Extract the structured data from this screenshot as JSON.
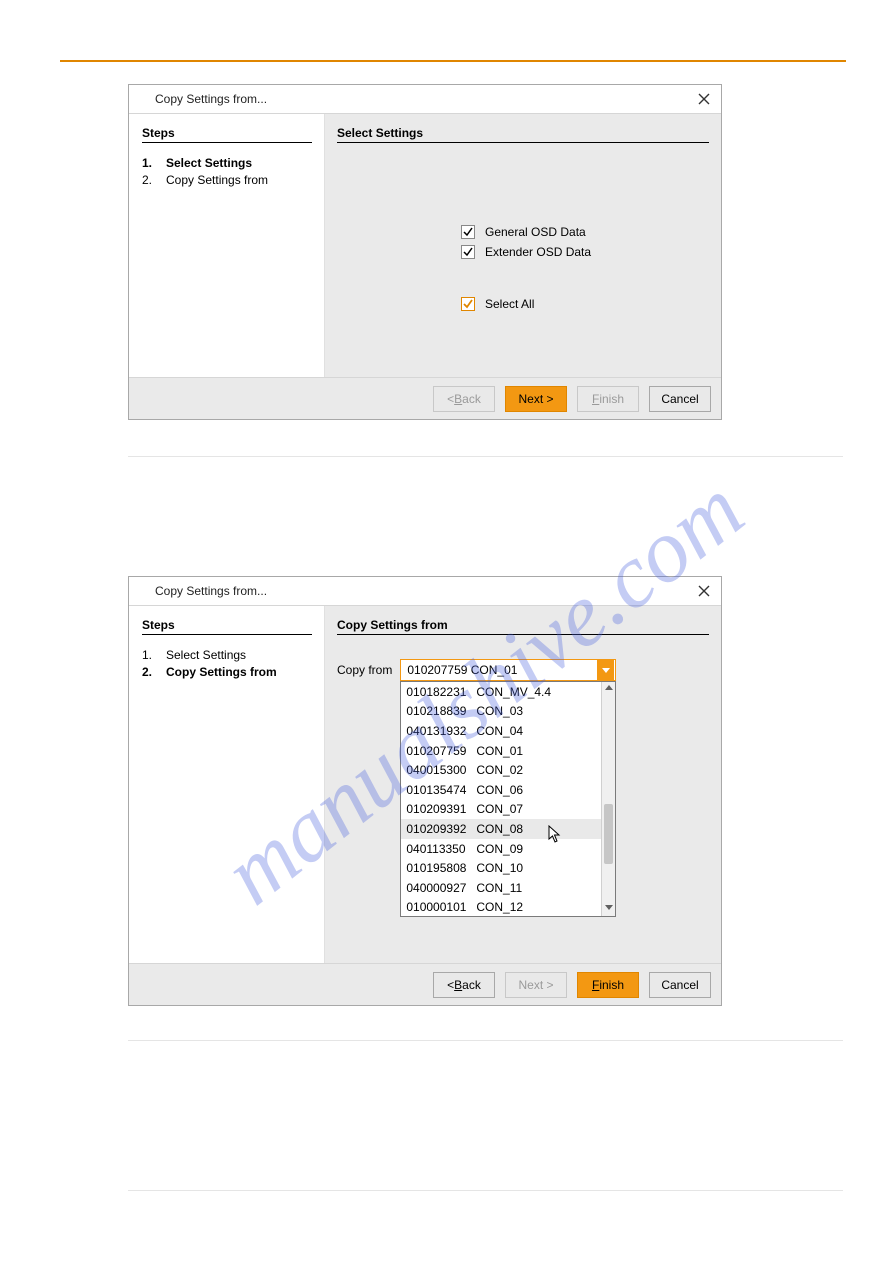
{
  "dialog1": {
    "title": "Copy Settings from...",
    "steps_header": "Steps",
    "steps": [
      {
        "num": "1.",
        "label": "Select Settings",
        "current": true
      },
      {
        "num": "2.",
        "label": "Copy Settings from",
        "current": false
      }
    ],
    "right_header": "Select Settings",
    "checks": {
      "general": "General OSD Data",
      "extender": "Extender OSD Data",
      "select_all": "Select All"
    },
    "buttons": {
      "back": "< Back",
      "next": "Next >",
      "finish": "Finish",
      "cancel": "Cancel"
    }
  },
  "dialog2": {
    "title": "Copy Settings from...",
    "steps_header": "Steps",
    "steps": [
      {
        "num": "1.",
        "label": "Select Settings",
        "current": false
      },
      {
        "num": "2.",
        "label": "Copy Settings from",
        "current": true
      }
    ],
    "right_header": "Copy Settings from",
    "copy_from_label": "Copy from",
    "combo_value": "010207759   CON_01",
    "options": [
      {
        "id": "010182231",
        "name": "CON_MV_4.4"
      },
      {
        "id": "010218839",
        "name": "CON_03"
      },
      {
        "id": "040131932",
        "name": "CON_04"
      },
      {
        "id": "010207759",
        "name": "CON_01"
      },
      {
        "id": "040015300",
        "name": "CON_02"
      },
      {
        "id": "010135474",
        "name": "CON_06"
      },
      {
        "id": "010209391",
        "name": "CON_07"
      },
      {
        "id": "010209392",
        "name": "CON_08"
      },
      {
        "id": "040113350",
        "name": "CON_09"
      },
      {
        "id": "010195808",
        "name": "CON_10"
      },
      {
        "id": "040000927",
        "name": "CON_11"
      },
      {
        "id": "010000101",
        "name": "CON_12"
      }
    ],
    "hover_index": 7,
    "buttons": {
      "back": "< Back",
      "next": "Next >",
      "finish": "Finish",
      "cancel": "Cancel"
    }
  },
  "watermark_text": "manualshive.com"
}
